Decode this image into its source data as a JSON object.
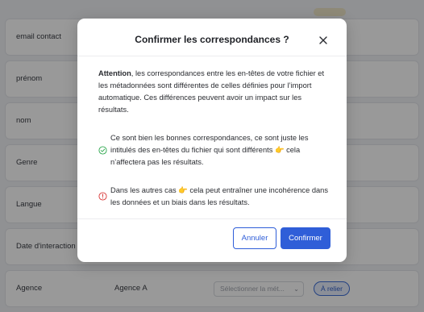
{
  "background": {
    "rows": [
      {
        "label": "email contact",
        "value": ""
      },
      {
        "label": "prénom",
        "value": ""
      },
      {
        "label": "nom",
        "value": ""
      },
      {
        "label": "Genre",
        "value": ""
      },
      {
        "label": "Langue",
        "value": ""
      },
      {
        "label": "Date d'interaction",
        "value": ""
      },
      {
        "label": "Agence",
        "value": "Agence A",
        "select_placeholder": "Sélectionner la mét...",
        "link_label": "À relier"
      }
    ]
  },
  "modal": {
    "title": "Confirmer les correspondances ?",
    "intro_bold": "Attention",
    "intro_rest": ", les correspondances entre les en-têtes de votre fichier et les métadonnées sont différentes de celles définies pour l’import automatique. Ces différences peuvent avoir un impact sur les résultats.",
    "ok_text": "Ce sont bien les bonnes correspondances, ce sont juste les intitulés des en-têtes du fichier qui sont différents 👉 cela n’affectera pas les résultats.",
    "warn_text": "Dans les autres cas 👉 cela peut entraîner une incohérence dans les données et un biais dans les résultats.",
    "cancel_label": "Annuler",
    "confirm_label": "Confirmer"
  },
  "colors": {
    "accent": "#2f5ed8",
    "success": "#2fa84f",
    "danger": "#d93a3a",
    "overlay": "rgba(0,0,0,0.40)"
  },
  "icons": {
    "close": "close-icon",
    "ok": "check-circle-icon",
    "warn": "alert-circle-icon",
    "select": "chevron-down-icon"
  }
}
